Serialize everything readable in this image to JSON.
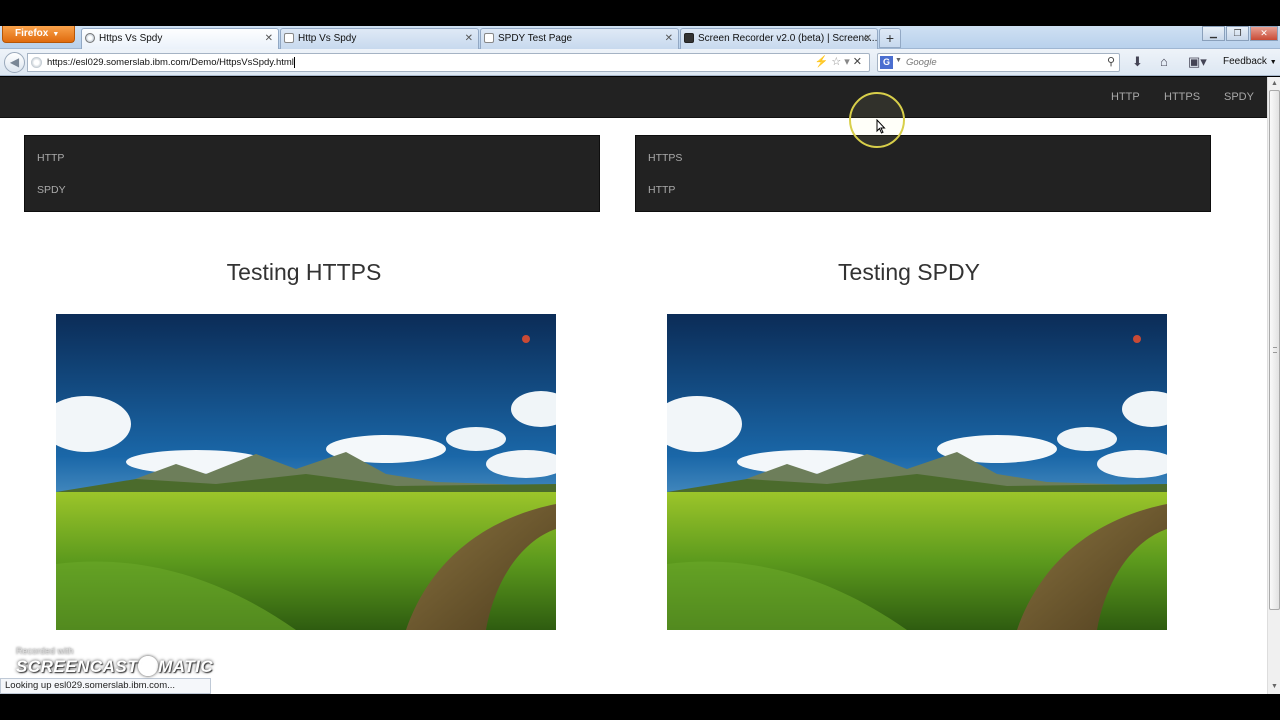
{
  "browser": {
    "menu_button": "Firefox",
    "tabs": [
      {
        "title": "Https Vs Spdy",
        "active": true
      },
      {
        "title": "Http Vs Spdy",
        "active": false
      },
      {
        "title": "SPDY Test Page",
        "active": false
      },
      {
        "title": "Screen Recorder v2.0 (beta) | Screenc...",
        "active": false
      }
    ],
    "new_tab": "+",
    "url": "https://esl029.somerslab.ibm.com/Demo/HttpsVsSpdy.html",
    "search_placeholder": "Google",
    "search_engine": "G",
    "feedback": "Feedback",
    "status": "Looking up esl029.somerslab.ibm.com..."
  },
  "page": {
    "nav_links": [
      "HTTP",
      "HTTPS",
      "SPDY"
    ],
    "left_panel": [
      "HTTP",
      "SPDY"
    ],
    "right_panel": [
      "HTTPS",
      "HTTP"
    ],
    "left_heading": "Testing HTTPS",
    "right_heading": "Testing SPDY"
  },
  "watermark": {
    "line1": "Recorded with",
    "brand_left": "SCREENCAST",
    "brand_right": "MATIC"
  },
  "colors": {
    "navbar_bg": "#222222",
    "nav_text": "#a9a9a9",
    "firefox_orange": "#e06b0e",
    "cursor_ring": "#d8cf4a"
  }
}
